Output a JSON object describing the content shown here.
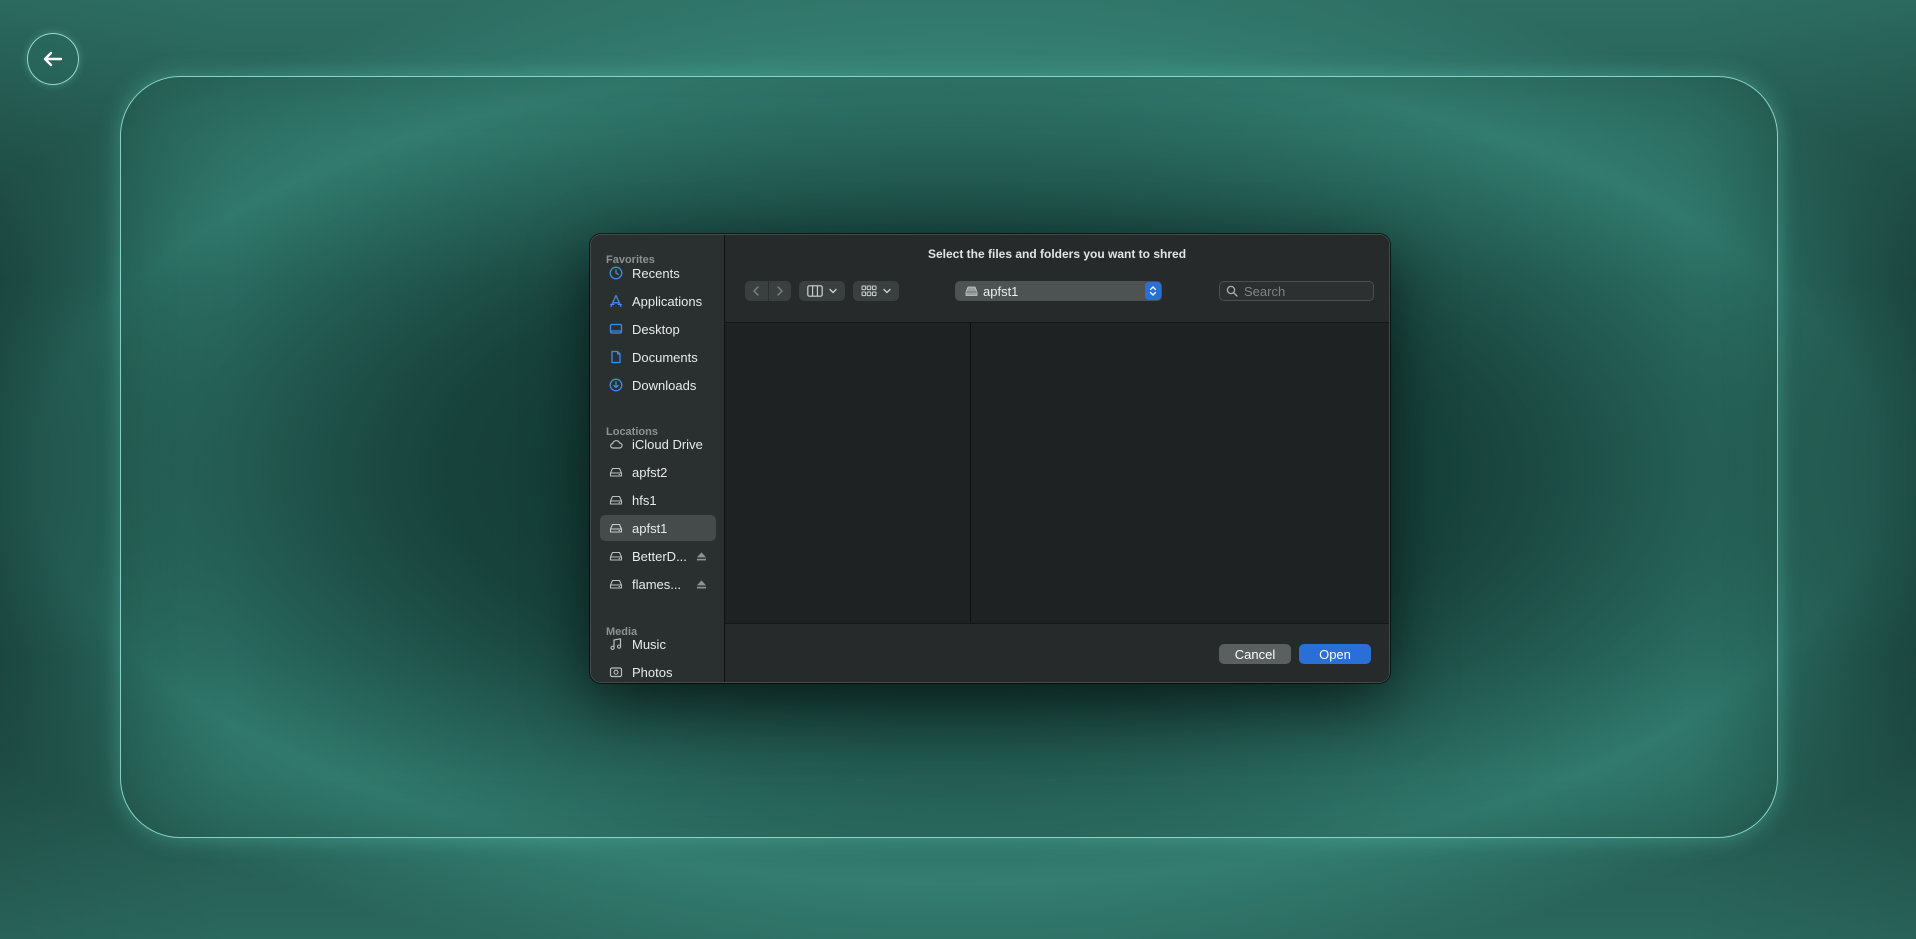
{
  "app": {
    "back_icon": "arrow-left-icon"
  },
  "dialog": {
    "title": "Select the files and folders you want to shred",
    "sidebar": {
      "sections": [
        {
          "title": "Favorites",
          "items": [
            {
              "label": "Recents",
              "icon": "clock-icon"
            },
            {
              "label": "Applications",
              "icon": "applications-icon"
            },
            {
              "label": "Desktop",
              "icon": "desktop-icon"
            },
            {
              "label": "Documents",
              "icon": "document-icon"
            },
            {
              "label": "Downloads",
              "icon": "download-icon"
            }
          ]
        },
        {
          "title": "Locations",
          "items": [
            {
              "label": "iCloud Drive",
              "icon": "cloud-icon"
            },
            {
              "label": "apfst2",
              "icon": "drive-icon"
            },
            {
              "label": "hfs1",
              "icon": "drive-icon"
            },
            {
              "label": "apfst1",
              "icon": "drive-icon",
              "selected": true
            },
            {
              "label": "BetterD...",
              "icon": "drive-icon",
              "eject": true
            },
            {
              "label": "flames...",
              "icon": "drive-icon",
              "eject": true
            }
          ]
        },
        {
          "title": "Media",
          "items": [
            {
              "label": "Music",
              "icon": "music-icon"
            },
            {
              "label": "Photos",
              "icon": "photos-icon"
            }
          ]
        }
      ]
    },
    "toolbar": {
      "location": "apfst1",
      "search_placeholder": "Search",
      "search_value": ""
    },
    "footer": {
      "cancel_label": "Cancel",
      "open_label": "Open"
    },
    "colors": {
      "accent": "#2a6fd6",
      "frame_border": "#96e6d7",
      "background": "#1e4a44"
    }
  }
}
